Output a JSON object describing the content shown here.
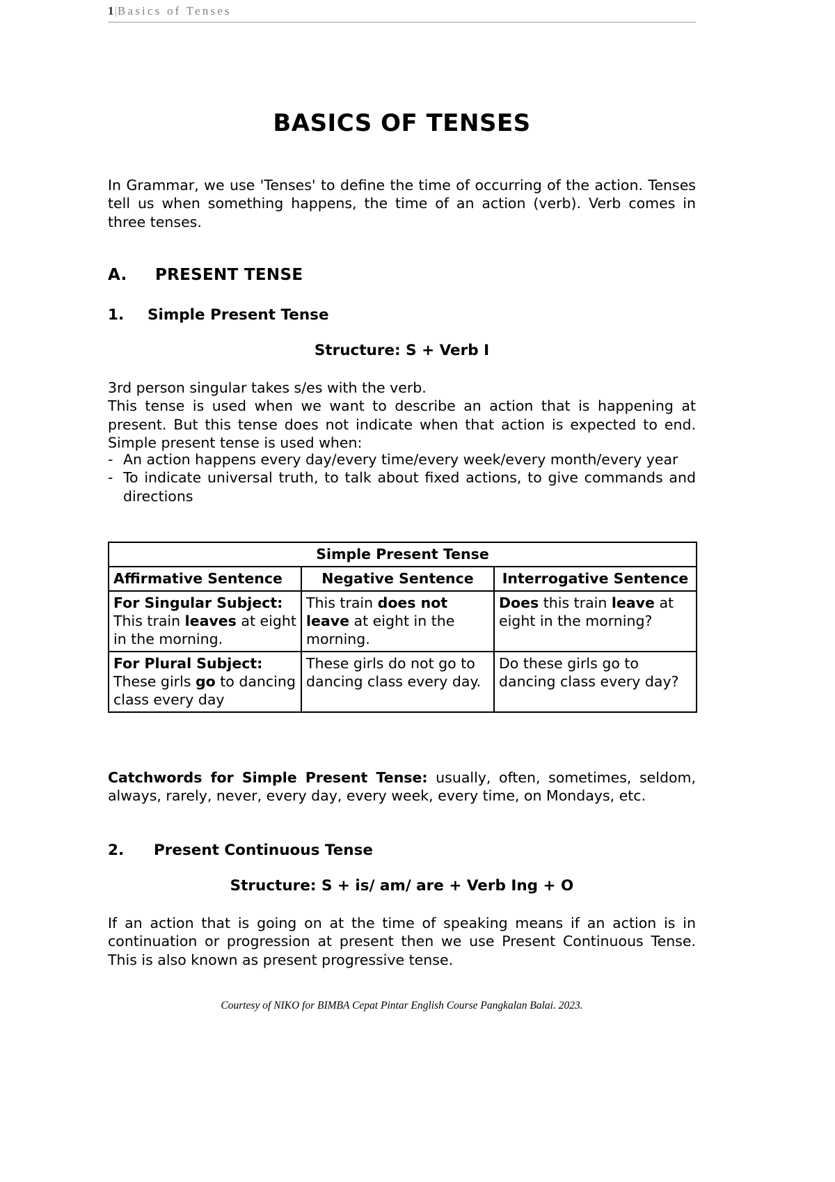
{
  "header": {
    "page_number": "1",
    "separator": "|",
    "title": "Basics of Tenses"
  },
  "title": "BASICS OF TENSES",
  "intro": "In Grammar, we use 'Tenses' to define the time of occurring of the action. Tenses tell us when something happens, the time of an action (verb). Verb comes in three tenses.",
  "section_a": {
    "label": "A.",
    "heading": "PRESENT TENSE"
  },
  "item1": {
    "label": "1.",
    "heading": "Simple Present Tense",
    "structure": "Structure: S + Verb I",
    "paragraph_line1": "3rd person singular takes s/es with the verb.",
    "paragraph_line2": "This tense is used when we want to describe an action that is happening at present. But this tense does not indicate when that action is expected to end. Simple present tense is used when:",
    "bullets": [
      {
        "dash": "-",
        "text": "An action happens every day/every time/every week/every month/every year"
      },
      {
        "dash": "-",
        "text": "To indicate universal truth, to talk about fixed actions, to give commands and directions"
      }
    ]
  },
  "table": {
    "caption": "Simple Present Tense",
    "columns": [
      "Affirmative Sentence",
      "Negative Sentence",
      "Interrogative Sentence"
    ],
    "rows": [
      {
        "affirmative": {
          "bold_prefix": "For Singular Subject:",
          "rest": " This train ",
          "bold_mid": "leaves",
          "tail": " at eight in the morning."
        },
        "negative": {
          "lead": "This train ",
          "bold": "does not leave",
          "tail": " at eight in the morning."
        },
        "interrogative": {
          "bold_lead": "Does",
          "mid": " this train ",
          "bold_mid": "leave",
          "tail": " at eight in the morning?"
        }
      },
      {
        "affirmative": {
          "bold_prefix": "For Plural Subject:",
          "rest": " These girls ",
          "bold_mid": "go",
          "tail": " to dancing class every day"
        },
        "negative": {
          "lead": "These girls do not go to dancing class every day.",
          "bold": "",
          "tail": ""
        },
        "interrogative": {
          "bold_lead": "",
          "mid": "Do these girls go to dancing class every day?",
          "bold_mid": "",
          "tail": ""
        }
      }
    ]
  },
  "catchwords": {
    "label": "Catchwords for Simple Present Tense:",
    "text": " usually, often, sometimes, seldom, always, rarely, never, every day, every week, every time, on Mondays, etc."
  },
  "item2": {
    "label": "2.",
    "heading": "Present Continuous Tense",
    "structure": "Structure: S + is/ am/ are + Verb Ing + O",
    "paragraph": "If an action that is going on at the time of speaking means if an action is in continuation or progression at present then we use Present Continuous Tense. This is also known as present progressive tense."
  },
  "footer": "Courtesy of NIKO for BIMBA Cepat Pintar English Course Pangkalan Balai. 2023."
}
